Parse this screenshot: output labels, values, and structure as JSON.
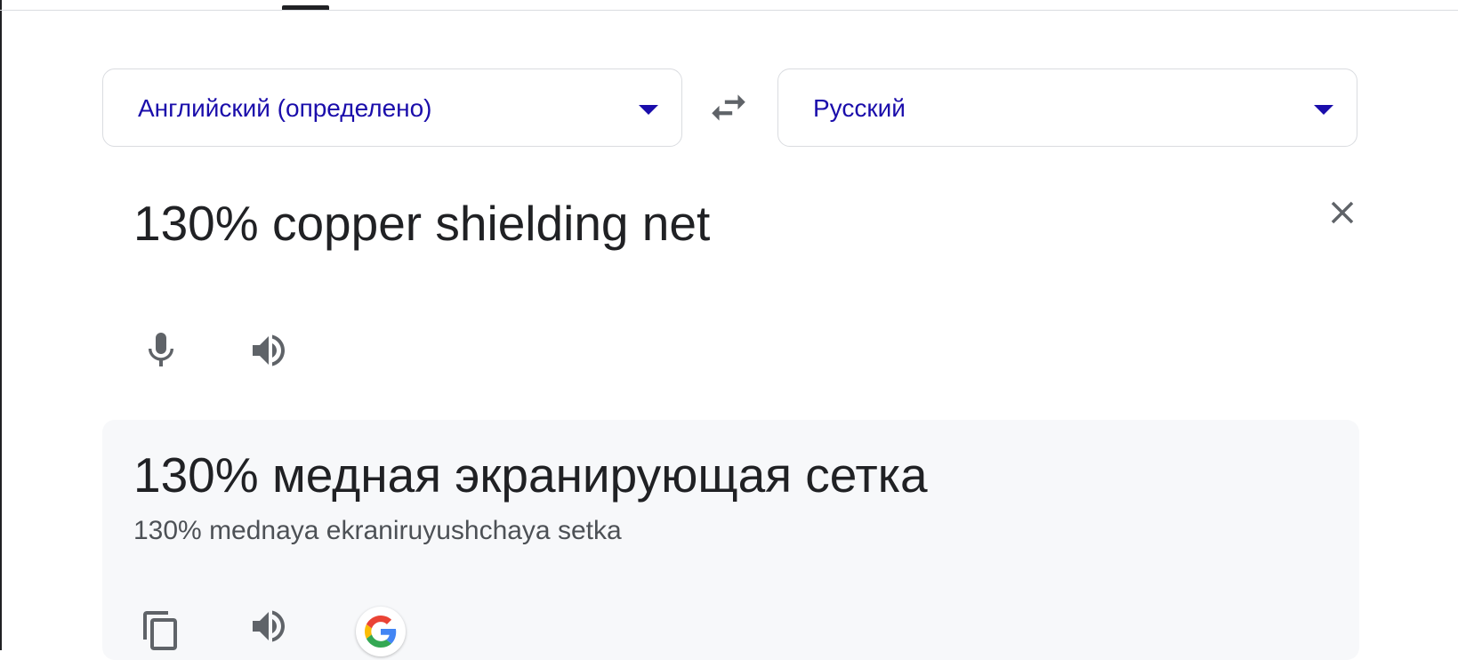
{
  "source_language": {
    "label": "Английский (определено)"
  },
  "target_language": {
    "label": "Русский"
  },
  "input": {
    "text": "130% copper shielding net"
  },
  "output": {
    "translation": "130% медная экранирующая сетка",
    "transliteration": "130% mednaya ekraniruyushchaya setka"
  },
  "icons": {
    "swap": "swap-icon",
    "clear": "close-icon",
    "mic": "microphone-icon",
    "speaker": "speaker-icon",
    "copy": "copy-icon",
    "google": "google-g-icon",
    "dropdown": "caret-down-icon"
  },
  "colors": {
    "language_label": "#1a0dab",
    "text": "#202124",
    "muted_text": "#4d5156",
    "icon": "#5f6368",
    "result_background": "#f7f8fa",
    "border": "#dadce0"
  }
}
